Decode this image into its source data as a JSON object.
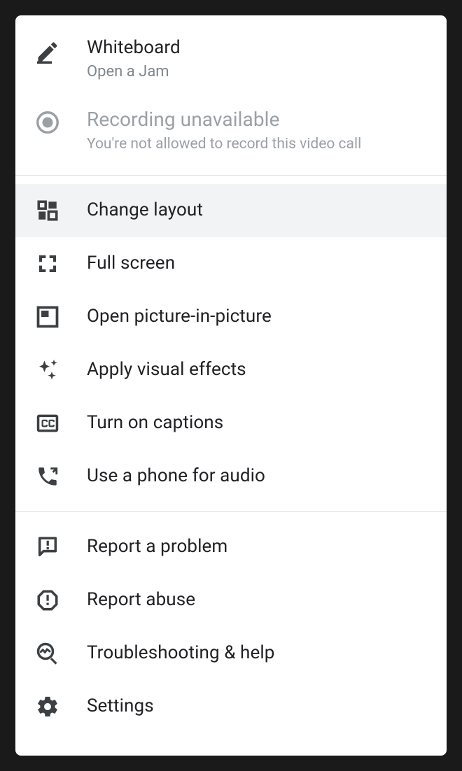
{
  "menu": {
    "section1": {
      "whiteboard": {
        "title": "Whiteboard",
        "subtitle": "Open a Jam"
      },
      "recording": {
        "title": "Recording unavailable",
        "subtitle": "You're not allowed to record this video call"
      }
    },
    "section2": {
      "changeLayout": {
        "label": "Change layout"
      },
      "fullScreen": {
        "label": "Full screen"
      },
      "pip": {
        "label": "Open picture-in-picture"
      },
      "visualEffects": {
        "label": "Apply visual effects"
      },
      "captions": {
        "label": "Turn on captions"
      },
      "phoneAudio": {
        "label": "Use a phone for audio"
      }
    },
    "section3": {
      "reportProblem": {
        "label": "Report a problem"
      },
      "reportAbuse": {
        "label": "Report abuse"
      },
      "troubleshooting": {
        "label": "Troubleshooting & help"
      },
      "settings": {
        "label": "Settings"
      }
    }
  }
}
